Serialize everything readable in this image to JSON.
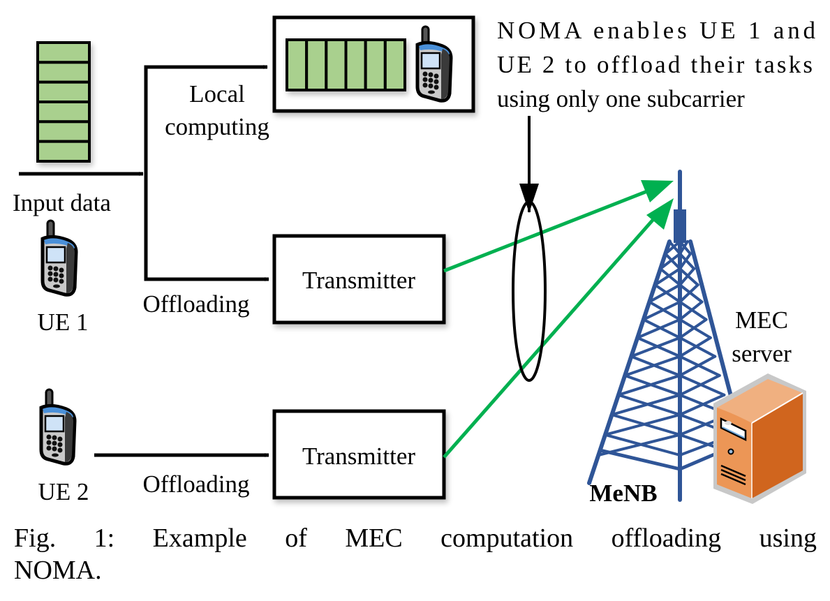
{
  "figure": {
    "labels": {
      "input_data": "Input data",
      "local_computing_line1": "Local",
      "local_computing_line2": "computing",
      "offloading_ue1": "Offloading",
      "offloading_ue2": "Offloading",
      "transmitter_1": "Transmitter",
      "transmitter_2": "Transmitter",
      "ue1": "UE 1",
      "ue2": "UE 2",
      "mec_server_line1": "MEC",
      "mec_server_line2": "server",
      "menb": "MeNB"
    },
    "annotation": {
      "line1": "NOMA  enables  UE  1  and",
      "line2": "UE 2 to offload their tasks",
      "line3": "using only one subcarrier"
    },
    "queue_blocks": 6,
    "colors": {
      "queue_fill": "#a9d08e",
      "link_green": "#00b050",
      "tower_blue": "#2f5597",
      "server_orange": "#e07b39",
      "phone_screen_blue": "#4a90d9"
    }
  },
  "caption": {
    "line1": "Fig. 1: Example of MEC computation offloading using",
    "line2": "NOMA."
  }
}
